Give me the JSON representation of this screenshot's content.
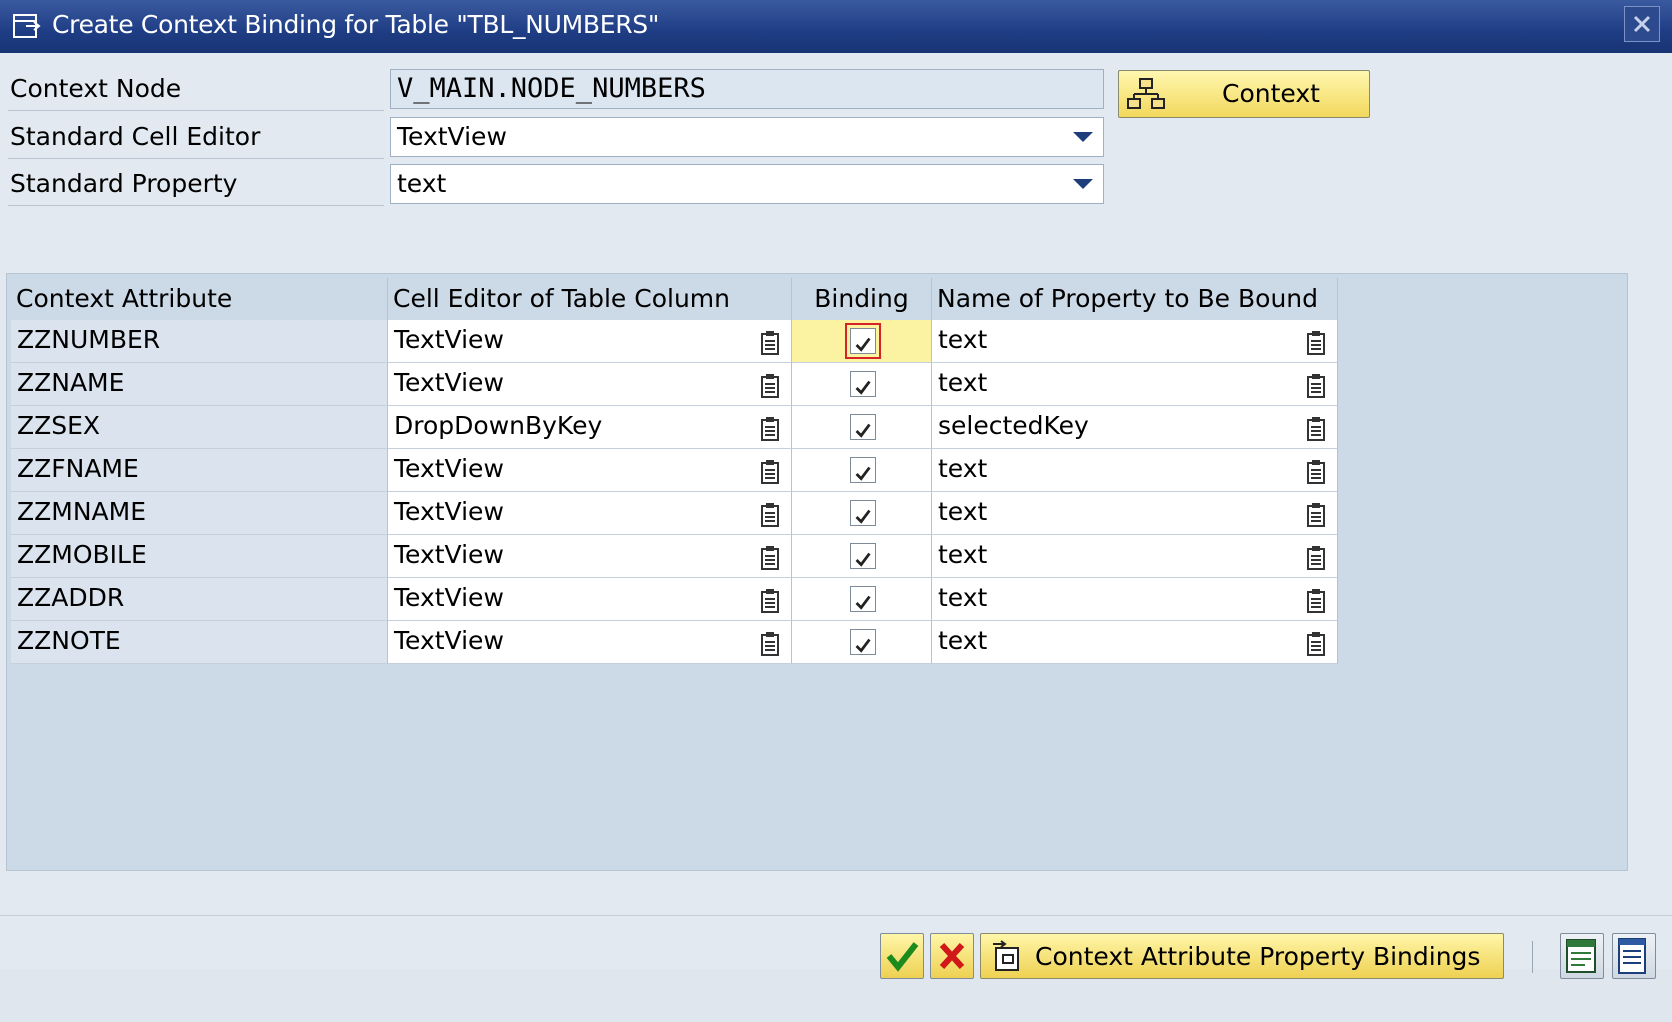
{
  "window": {
    "title": "Create Context Binding for Table \"TBL_NUMBERS\""
  },
  "form": {
    "context_node": {
      "label": "Context Node",
      "value": "V_MAIN.NODE_NUMBERS"
    },
    "standard_cell_editor": {
      "label": "Standard Cell Editor",
      "value": "TextView"
    },
    "standard_property": {
      "label": "Standard Property",
      "value": "text"
    },
    "context_button_label": "Context"
  },
  "table": {
    "headers": [
      "Context Attribute",
      "Cell Editor of Table Column",
      "Binding",
      "Name of Property to Be Bound"
    ],
    "rows": [
      {
        "attribute": "ZZNUMBER",
        "cell_editor": "TextView",
        "binding": true,
        "property": "text"
      },
      {
        "attribute": "ZZNAME",
        "cell_editor": "TextView",
        "binding": true,
        "property": "text"
      },
      {
        "attribute": "ZZSEX",
        "cell_editor": "DropDownByKey",
        "binding": true,
        "property": "selectedKey"
      },
      {
        "attribute": "ZZFNAME",
        "cell_editor": "TextView",
        "binding": true,
        "property": "text"
      },
      {
        "attribute": "ZZMNAME",
        "cell_editor": "TextView",
        "binding": true,
        "property": "text"
      },
      {
        "attribute": "ZZMOBILE",
        "cell_editor": "TextView",
        "binding": true,
        "property": "text"
      },
      {
        "attribute": "ZZADDR",
        "cell_editor": "TextView",
        "binding": true,
        "property": "text"
      },
      {
        "attribute": "ZZNOTE",
        "cell_editor": "TextView",
        "binding": true,
        "property": "text"
      }
    ]
  },
  "footer": {
    "bindings_button_label": "Context Attribute Property Bindings"
  },
  "colors": {
    "titlebar": "#1f3d84",
    "button_yellow": "#f2d85c",
    "highlight_cell": "#fbf3a2",
    "table_bg": "#ccd9e6"
  }
}
